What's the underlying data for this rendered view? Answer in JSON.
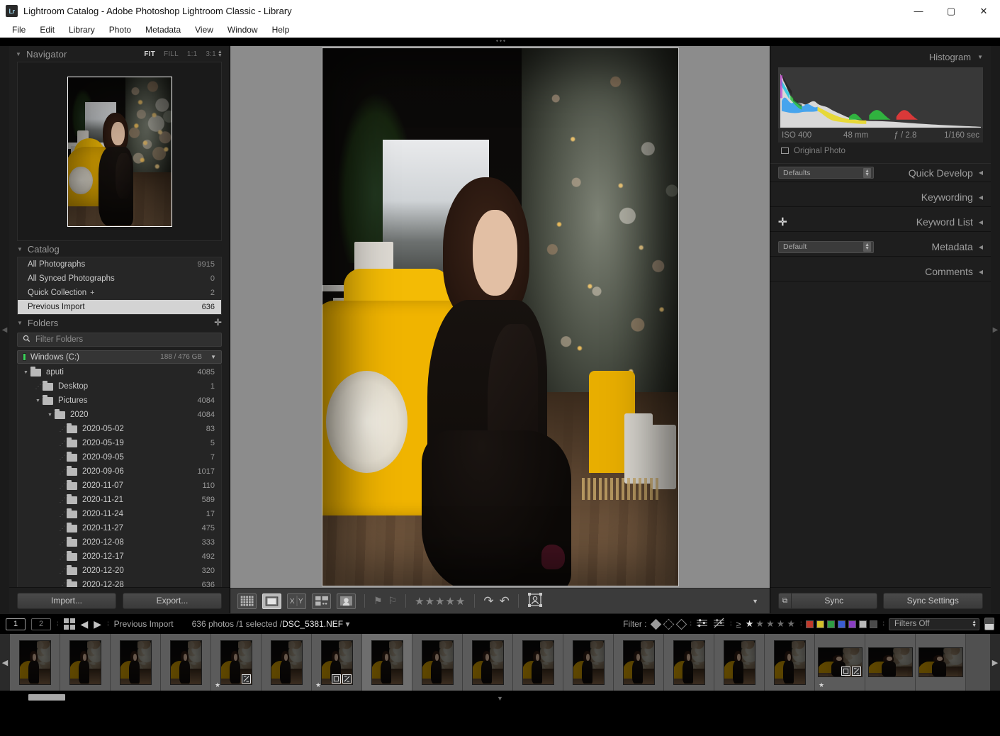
{
  "window": {
    "title": "Lightroom Catalog - Adobe Photoshop Lightroom Classic - Library",
    "logo_text": "Lr",
    "minimize": "—",
    "maximize": "▢",
    "close": "✕"
  },
  "menubar": {
    "items": [
      "File",
      "Edit",
      "Library",
      "Photo",
      "Metadata",
      "View",
      "Window",
      "Help"
    ]
  },
  "navigator": {
    "title": "Navigator",
    "triangle": "▼",
    "modes": [
      {
        "label": "FIT",
        "active": true
      },
      {
        "label": "FILL",
        "active": false
      },
      {
        "label": "1:1",
        "active": false
      },
      {
        "label": "3:1",
        "active": false
      }
    ],
    "stepper_up": "▲",
    "stepper_down": "▼"
  },
  "catalog": {
    "title": "Catalog",
    "triangle": "▼",
    "items": [
      {
        "label": "All Photographs",
        "count": "9915",
        "selected": false,
        "plus": ""
      },
      {
        "label": "All Synced Photographs",
        "count": "0",
        "selected": false,
        "plus": ""
      },
      {
        "label": "Quick Collection",
        "count": "2",
        "selected": false,
        "plus": "+"
      },
      {
        "label": "Previous Import",
        "count": "636",
        "selected": true,
        "plus": ""
      }
    ]
  },
  "folders": {
    "title": "Folders",
    "triangle": "▼",
    "add_button": "✛",
    "filter_placeholder": "Filter Folders",
    "search_icon": "search-icon",
    "volume": {
      "name": "Windows (C:)",
      "space": "188 / 476 GB",
      "caret": "▼",
      "bar_color": "#3bd35a"
    },
    "tree": [
      {
        "label": "aputi",
        "count": "4085",
        "depth": 0,
        "twisty": "▼"
      },
      {
        "label": "Desktop",
        "count": "1",
        "depth": 1,
        "twisty": "dots"
      },
      {
        "label": "Pictures",
        "count": "4084",
        "depth": 1,
        "twisty": "▼"
      },
      {
        "label": "2020",
        "count": "4084",
        "depth": 2,
        "twisty": "▼"
      },
      {
        "label": "2020-05-02",
        "count": "83",
        "depth": 3,
        "twisty": "dots"
      },
      {
        "label": "2020-05-19",
        "count": "5",
        "depth": 3,
        "twisty": "dots"
      },
      {
        "label": "2020-09-05",
        "count": "7",
        "depth": 3,
        "twisty": "dots"
      },
      {
        "label": "2020-09-06",
        "count": "1017",
        "depth": 3,
        "twisty": "dots"
      },
      {
        "label": "2020-11-07",
        "count": "110",
        "depth": 3,
        "twisty": "dots"
      },
      {
        "label": "2020-11-21",
        "count": "589",
        "depth": 3,
        "twisty": "dots"
      },
      {
        "label": "2020-11-24",
        "count": "17",
        "depth": 3,
        "twisty": "dots"
      },
      {
        "label": "2020-11-27",
        "count": "475",
        "depth": 3,
        "twisty": "dots"
      },
      {
        "label": "2020-12-08",
        "count": "333",
        "depth": 3,
        "twisty": "dots"
      },
      {
        "label": "2020-12-17",
        "count": "492",
        "depth": 3,
        "twisty": "dots"
      },
      {
        "label": "2020-12-20",
        "count": "320",
        "depth": 3,
        "twisty": "dots"
      },
      {
        "label": "2020-12-28",
        "count": "636",
        "depth": 3,
        "twisty": "dots"
      }
    ]
  },
  "left_buttons": {
    "import": "Import...",
    "export": "Export..."
  },
  "histogram": {
    "title": "Histogram",
    "triangle": "▼",
    "exif": {
      "iso": "ISO 400",
      "focal": "48 mm",
      "aperture": "ƒ / 2.8",
      "shutter": "1/160 sec"
    },
    "original_photo": "Original Photo"
  },
  "right_sections": [
    {
      "label": "Quick Develop",
      "select": "Defaults",
      "plus": false,
      "arrow": "◀"
    },
    {
      "label": "Keywording",
      "select": null,
      "plus": false,
      "arrow": "◀"
    },
    {
      "label": "Keyword List",
      "select": null,
      "plus": true,
      "arrow": "◀"
    },
    {
      "label": "Metadata",
      "select": "Default",
      "plus": false,
      "arrow": "◀"
    },
    {
      "label": "Comments",
      "select": null,
      "plus": false,
      "arrow": "◀"
    }
  ],
  "sync": {
    "sync_label": "Sync",
    "sync_settings_label": "Sync Settings",
    "mini_icon": "switch-icon"
  },
  "toolbar": {
    "view_modes": [
      {
        "name": "grid-view-icon",
        "glyph": "▦",
        "active": false
      },
      {
        "name": "loupe-view-icon",
        "glyph": "▢",
        "active": true
      },
      {
        "name": "compare-view-icon",
        "glyph": "XY",
        "active": false
      },
      {
        "name": "survey-view-icon",
        "glyph": "▤",
        "active": false
      },
      {
        "name": "people-view-icon",
        "glyph": "☺",
        "active": false
      }
    ],
    "flag_icons": [
      "flag-pick-icon",
      "flag-reject-icon"
    ],
    "stars": "★★★★★",
    "rotate_right": "↷",
    "rotate_left": "↶",
    "face_tag_icon": "face-region-icon",
    "caret": "▼"
  },
  "statusbar": {
    "page_1": "1",
    "page_2": "2",
    "grid_icon": "grid-toggle-icon",
    "prev_arrow": "◀",
    "next_arrow": "▶",
    "source": "Previous Import",
    "selection": "636 photos /1 selected /",
    "filename": "DSC_5381.NEF",
    "filename_caret": "▾",
    "filter_label": "Filter :",
    "filter_flags": [
      "flag-pick-diamond",
      "flag-unflag-diamond",
      "flag-reject-diamond"
    ],
    "edit_icons": [
      "edited-icon",
      "unedited-icon"
    ],
    "rating_prefix": "≥",
    "rating_stars": [
      true,
      false,
      false,
      false,
      false
    ],
    "color_labels": [
      "#c0392b",
      "#d4c02a",
      "#2f9e44",
      "#3b5ed1",
      "#8b3fc4",
      "#b9b9b9",
      "#4a4a4a"
    ],
    "filters_select": "Filters Off",
    "end_icon": "filmstrip-toggle-icon"
  },
  "filmstrip": {
    "left_arrow": "◀",
    "right_arrow": "▶",
    "thumbnails": [
      {
        "orientation": "portrait",
        "badges": [],
        "star": false,
        "selected": false
      },
      {
        "orientation": "portrait",
        "badges": [],
        "star": false,
        "selected": false
      },
      {
        "orientation": "portrait",
        "badges": [],
        "star": false,
        "selected": false
      },
      {
        "orientation": "portrait",
        "badges": [],
        "star": false,
        "selected": false
      },
      {
        "orientation": "portrait",
        "badges": [
          "develop-badge"
        ],
        "star": true,
        "selected": false
      },
      {
        "orientation": "portrait",
        "badges": [],
        "star": false,
        "selected": false
      },
      {
        "orientation": "portrait",
        "badges": [
          "crop-badge",
          "develop-badge"
        ],
        "star": true,
        "selected": false
      },
      {
        "orientation": "portrait",
        "badges": [],
        "star": false,
        "selected": true
      },
      {
        "orientation": "portrait",
        "badges": [],
        "star": false,
        "selected": false
      },
      {
        "orientation": "portrait",
        "badges": [],
        "star": false,
        "selected": false
      },
      {
        "orientation": "portrait",
        "badges": [],
        "star": false,
        "selected": false
      },
      {
        "orientation": "portrait",
        "badges": [],
        "star": false,
        "selected": false
      },
      {
        "orientation": "portrait",
        "badges": [],
        "star": false,
        "selected": false
      },
      {
        "orientation": "portrait",
        "badges": [],
        "star": false,
        "selected": false
      },
      {
        "orientation": "portrait",
        "badges": [],
        "star": false,
        "selected": false
      },
      {
        "orientation": "portrait",
        "badges": [],
        "star": false,
        "selected": false
      },
      {
        "orientation": "landscape",
        "badges": [
          "crop-badge",
          "develop-badge"
        ],
        "star": true,
        "selected": false
      },
      {
        "orientation": "landscape",
        "badges": [],
        "star": false,
        "selected": false
      },
      {
        "orientation": "landscape",
        "badges": [],
        "star": false,
        "selected": false
      }
    ],
    "bottom_caret": "▼"
  },
  "photo": {
    "description": "Woman in black lace dress seated on yellow armchair beside a decorated Christmas tree on a wooden floor",
    "filename": "DSC_5381.NEF"
  }
}
